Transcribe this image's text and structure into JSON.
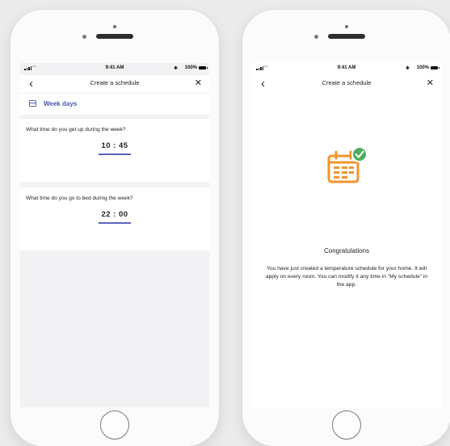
{
  "left_phone": {
    "status_bar": {
      "time": "9:41 AM",
      "bluetooth": "✱",
      "battery": "100%"
    },
    "nav": {
      "title": "Create a schedule",
      "back": "‹",
      "close": "✕"
    },
    "section": {
      "label": "Week days"
    },
    "wakeup": {
      "question": "What time do you get up during the week?",
      "time": "10 : 45"
    },
    "bedtime": {
      "question": "What time do you go to bed during the week?",
      "time": "22 : 00"
    }
  },
  "right_phone": {
    "status_bar": {
      "time": "9:41 AM",
      "bluetooth": "✱",
      "battery": "100%"
    },
    "nav": {
      "title": "Create a schedule",
      "back": "‹",
      "close": "✕"
    },
    "congrats": {
      "title": "Congratulations",
      "text": "You have just created a temperature schedule for your home. It will apply on every room. You can modify it any time in \"My schedule\" in the app."
    }
  },
  "colors": {
    "accent": "#4b57a8",
    "underline": "#5865b8",
    "icon_orange": "#f0952d",
    "check_green": "#4cae5a"
  },
  "icons": [
    "back-icon",
    "close-icon",
    "calendar-icon",
    "calendar-check-icon",
    "home-button"
  ]
}
